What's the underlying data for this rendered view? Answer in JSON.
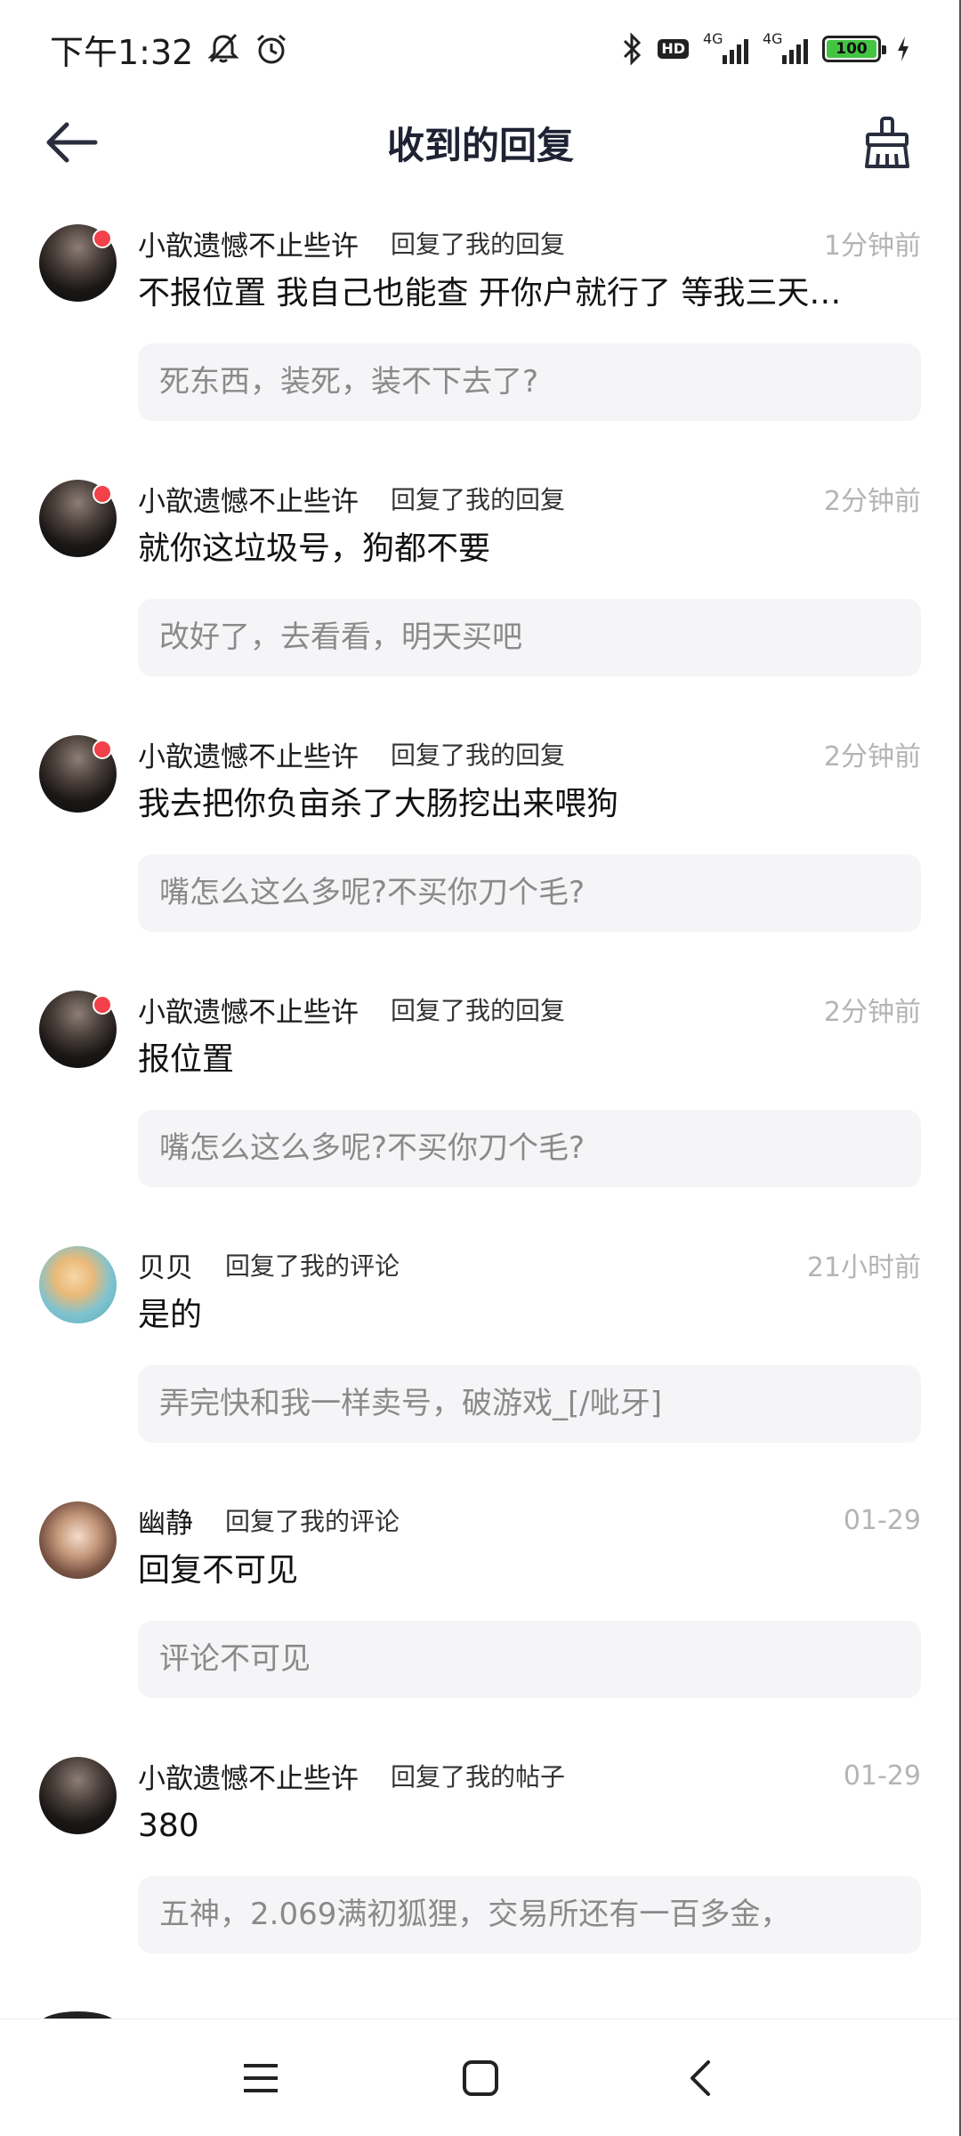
{
  "status_bar": {
    "time": "下午1:32",
    "network_1": "4G",
    "network_2": "4G",
    "hd_label": "HD",
    "battery_level": "100"
  },
  "header": {
    "title": "收到的回复",
    "back_icon": "arrow-left-icon",
    "clean_icon": "broom-icon"
  },
  "replies": [
    {
      "username": "小歆遗憾不止些许",
      "action": "回复了我的回复",
      "time": "1分钟前",
      "content": "不报位置 我自己也能查 开你户就行了 等我三天…",
      "quote": "死东西，装死，装不下去了?",
      "unread": true
    },
    {
      "username": "小歆遗憾不止些许",
      "action": "回复了我的回复",
      "time": "2分钟前",
      "content": "就你这垃圾号，狗都不要",
      "quote": "改好了，去看看，明天买吧",
      "unread": true
    },
    {
      "username": "小歆遗憾不止些许",
      "action": "回复了我的回复",
      "time": "2分钟前",
      "content": "我去把你负亩杀了大肠挖出来喂狗",
      "quote": "嘴怎么这么多呢?不买你刀个毛?",
      "unread": true
    },
    {
      "username": "小歆遗憾不止些许",
      "action": "回复了我的回复",
      "time": "2分钟前",
      "content": "报位置",
      "quote": "嘴怎么这么多呢?不买你刀个毛?",
      "unread": true
    },
    {
      "username": "贝贝",
      "action": "回复了我的评论",
      "time": "21小时前",
      "content": "是的",
      "quote": "弄完快和我一样卖号，破游戏_[/呲牙]",
      "unread": false
    },
    {
      "username": "幽静",
      "action": "回复了我的评论",
      "time": "01-29",
      "content": "回复不可见",
      "quote": "评论不可见",
      "unread": false
    },
    {
      "username": "小歆遗憾不止些许",
      "action": "回复了我的帖子",
      "time": "01-29",
      "content": "380",
      "quote": "五神，2.069满初狐狸，交易所还有一百多金，",
      "unread": false
    }
  ],
  "colors": {
    "unread_dot": "#f2414a",
    "quote_bg": "#f5f5f7",
    "time_text": "#b4b4b4",
    "battery_fill": "#43c443"
  },
  "nav": {
    "menu_icon": "menu-icon",
    "home_icon": "home-square-icon",
    "back_icon": "back-chevron-icon"
  }
}
